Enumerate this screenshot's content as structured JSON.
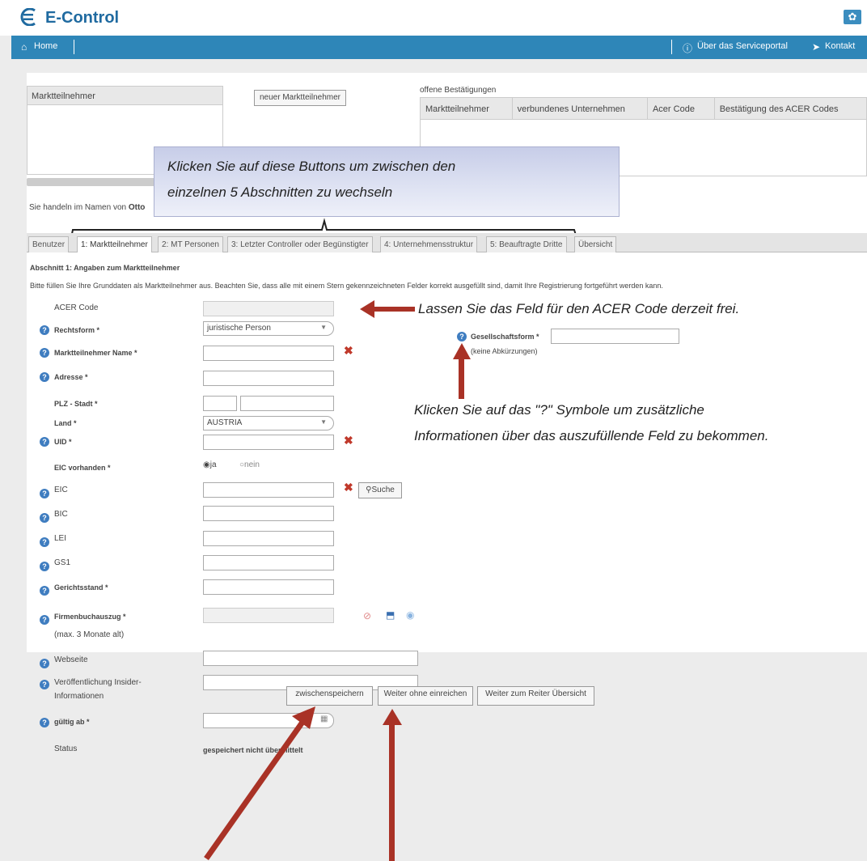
{
  "header": {
    "brand": "E-Control",
    "gear_icon": "gear-icon"
  },
  "nav": {
    "home": "Home",
    "about": "Über das Serviceportal",
    "contact": "Kontakt"
  },
  "top_panel": {
    "participants_heading": "Marktteilnehmer",
    "new_participant_button": "neuer Marktteilnehmer",
    "pending_heading": "offene Bestätigungen",
    "pending_columns": [
      "Marktteilnehmer",
      "verbundenes Unternehmen",
      "Acer Code",
      "Bestätigung des ACER Codes"
    ],
    "acting_for": "Sie handeln im Namen von",
    "acting_for_name": "Otto"
  },
  "callout_tabs": {
    "line1": "Klicken Sie auf diese Buttons um zwischen den",
    "line2": "einzelnen 5 Abschnitten zu wechseln"
  },
  "tabs": [
    "Benutzer",
    "1: Marktteilnehmer",
    "2: MT Personen",
    "3: Letzter Controller oder Begünstigter",
    "4: Unternehmensstruktur",
    "5: Beauftragte Dritte",
    "Übersicht"
  ],
  "form": {
    "section_title": "Abschnitt 1: Angaben zum Marktteilnehmer",
    "intro": "Bitte füllen Sie Ihre Grunddaten als Marktteilnehmer aus. Beachten Sie, dass alle mit einem Stern gekennzeichneten Felder korrekt ausgefüllt sind, damit Ihre Registrierung fortgeführt werden kann.",
    "acer_code": "ACER Code",
    "rechtsform": "Rechtsform *",
    "rechtsform_value": "juristische Person",
    "name": "Marktteilnehmer Name *",
    "adresse": "Adresse *",
    "plz": "PLZ - Stadt *",
    "land": "Land *",
    "land_value": "AUSTRIA",
    "uid": "UID *",
    "eic_vorhanden": "EIC vorhanden *",
    "radio_ja": "ja",
    "radio_nein": "nein",
    "eic": "EIC",
    "suche": "Suche",
    "bic": "BIC",
    "lei": "LEI",
    "gs1": "GS1",
    "gerichtsstand": "Gerichtsstand *",
    "firmenbuch": "Firmenbuchauszug *",
    "firmenbuch_note": "(max. 3 Monate alt)",
    "webseite": "Webseite",
    "insider_1": "Veröffentlichung Insider-",
    "insider_2": "Informationen",
    "gueltig": "gültig ab *",
    "status": "Status",
    "status_value": "gespeichert nicht übermittelt",
    "gesellschaftsform": "Gesellschaftsform *",
    "gesellschaftsform_note": "(keine Abkürzungen)"
  },
  "notes": {
    "acer": "Lassen Sie das Feld für den ACER Code derzeit frei.",
    "help_1": "Klicken Sie auf das \"?\" Symbole um zusätzliche",
    "help_2": "Informationen über das auszufüllende Feld zu bekommen."
  },
  "buttons": {
    "save": "zwischenspeichern",
    "next": "Weiter ohne einreichen",
    "overview": "Weiter zum Reiter Übersicht"
  },
  "colors": {
    "nav": "#2e86b8",
    "arrow": "#a93226",
    "brand": "#1f6aa0"
  }
}
